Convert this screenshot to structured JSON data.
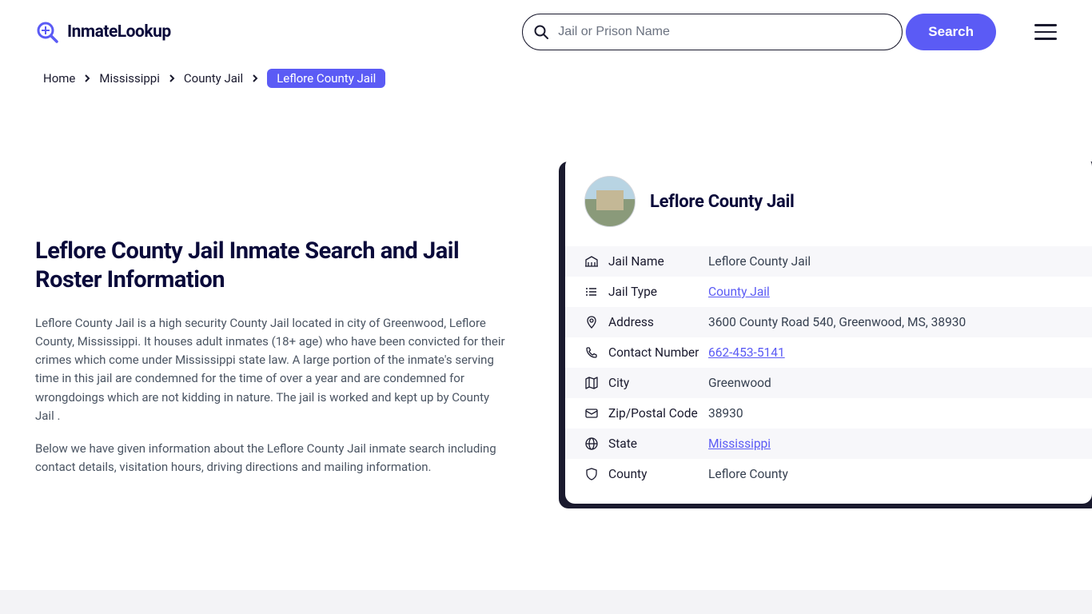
{
  "header": {
    "logo_text": "InmateLookup",
    "search_placeholder": "Jail or Prison Name",
    "search_button": "Search"
  },
  "breadcrumb": {
    "items": [
      "Home",
      "Mississippi",
      "County Jail"
    ],
    "current": "Leflore County Jail"
  },
  "page": {
    "title": "Leflore County Jail Inmate Search and Jail Roster Information",
    "para1": "Leflore County Jail is a high security County Jail located in city of Greenwood, Leflore County, Mississippi. It houses adult inmates (18+ age) who have been convicted for their crimes which come under Mississippi state law. A large portion of the inmate's serving time in this jail are condemned for the time of over a year and are condemned for wrongdoings which are not kidding in nature. The jail is worked and kept up by County Jail .",
    "para2": "Below we have given information about the Leflore County Jail inmate search including contact details, visitation hours, driving directions and mailing information."
  },
  "card": {
    "title": "Leflore County Jail",
    "rows": [
      {
        "label": "Jail Name",
        "value": "Leflore County Jail",
        "is_link": false,
        "icon": "building"
      },
      {
        "label": "Jail Type",
        "value": "County Jail",
        "is_link": true,
        "icon": "list"
      },
      {
        "label": "Address",
        "value": "3600 County Road 540, Greenwood, MS, 38930",
        "is_link": false,
        "icon": "pin"
      },
      {
        "label": "Contact Number",
        "value": "662-453-5141",
        "is_link": true,
        "icon": "phone"
      },
      {
        "label": "City",
        "value": "Greenwood",
        "is_link": false,
        "icon": "map"
      },
      {
        "label": "Zip/Postal Code",
        "value": "38930",
        "is_link": false,
        "icon": "envelope"
      },
      {
        "label": "State",
        "value": "Mississippi",
        "is_link": true,
        "icon": "globe"
      },
      {
        "label": "County",
        "value": "Leflore County",
        "is_link": false,
        "icon": "shield"
      }
    ]
  }
}
